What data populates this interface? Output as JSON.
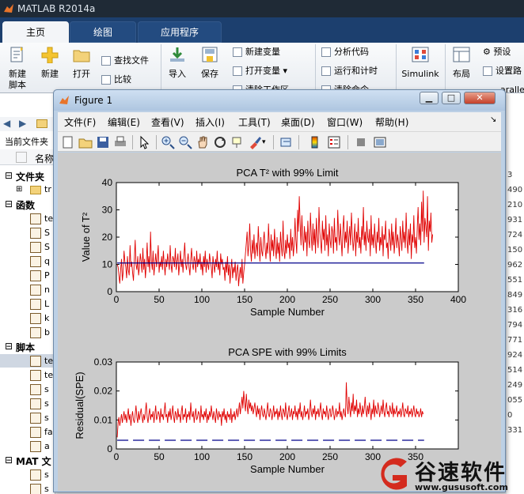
{
  "app": {
    "title": "MATLAB R2014a"
  },
  "tabs": [
    {
      "label": "主页"
    },
    {
      "label": "绘图"
    },
    {
      "label": "应用程序"
    }
  ],
  "ribbon": {
    "new_script": "新建\n脚本",
    "new": "新建",
    "open": "打开",
    "find_files": "查找文件",
    "compare": "比较",
    "import": "导入",
    "save": "保存",
    "new_variable": "新建变量",
    "open_variable": "打开变量",
    "clear_workspace": "清除工作区",
    "analyze_code": "分析代码",
    "run_and_time": "运行和计时",
    "clear_commands": "清除命令",
    "simulink": "Simulink",
    "layout": "布局",
    "preferences": "预设",
    "set_path": "设置路",
    "parallel": "aralle"
  },
  "left_panel": {
    "current_folder": "当前文件夹",
    "name_header": "名称",
    "sections": {
      "folders": "文件夹",
      "functions": "函数",
      "scripts": "脚本",
      "mat": "MAT 文"
    },
    "folder_item": "tr",
    "function_items": [
      "te",
      "S",
      "S",
      "q",
      "P",
      "n",
      "L",
      "k",
      "b"
    ],
    "script_items": [
      "te",
      "te",
      "s",
      "s",
      "s",
      "fa",
      "a"
    ],
    "mat_items": [
      "s",
      "s"
    ]
  },
  "right_numbers": [
    "3",
    "490",
    "210",
    "931",
    "724",
    "150",
    "962",
    "551",
    "849",
    "316",
    "794",
    "771",
    "924",
    "514",
    "249",
    "055",
    "0",
    "331"
  ],
  "figure": {
    "title": "Figure 1",
    "menu": [
      "文件(F)",
      "编辑(E)",
      "查看(V)",
      "插入(I)",
      "工具(T)",
      "桌面(D)",
      "窗口(W)",
      "帮助(H)"
    ],
    "toolbar_icons": [
      "new-figure-icon",
      "open-file-icon",
      "save-icon",
      "print-icon",
      "pointer-icon",
      "zoom-in-icon",
      "zoom-out-icon",
      "pan-icon",
      "rotate-icon",
      "data-cursor-icon",
      "brush-icon",
      "link-icon",
      "colorbar-icon",
      "legend-icon",
      "hide-plot-tools-icon",
      "show-plot-tools-icon"
    ]
  },
  "colors": {
    "series": "#e00000",
    "limit": "#00008b",
    "accent": "#1c3f6e"
  },
  "chart_data": [
    {
      "type": "line",
      "title": "PCA T² with 99% Limit",
      "xlabel": "Sample Number",
      "ylabel": "Value of T²",
      "xlim": [
        0,
        400
      ],
      "ylim": [
        0,
        40
      ],
      "xticks": [
        0,
        50,
        100,
        150,
        200,
        250,
        300,
        350,
        400
      ],
      "yticks": [
        0,
        10,
        20,
        30,
        40
      ],
      "series": [
        {
          "role": "data",
          "x_start": 1,
          "x_step": 1,
          "values": [
            10,
            9,
            6,
            3,
            8,
            12,
            4,
            7,
            15,
            11,
            9,
            5,
            13,
            8,
            6,
            17,
            9,
            11,
            7,
            4,
            12,
            19,
            10,
            8,
            13,
            6,
            9,
            14,
            11,
            7,
            16,
            8,
            12,
            5,
            10,
            18,
            9,
            13,
            7,
            22,
            11,
            8,
            15,
            6,
            10,
            14,
            9,
            12,
            17,
            7,
            11,
            9,
            13,
            8,
            15,
            10,
            6,
            12,
            9,
            14,
            11,
            8,
            17,
            10,
            7,
            13,
            12,
            9,
            16,
            8,
            11,
            14,
            6,
            10,
            15,
            9,
            12,
            7,
            13,
            18,
            10,
            8,
            11,
            14,
            9,
            6,
            12,
            16,
            10,
            8,
            13,
            11,
            7,
            15,
            9,
            12,
            10,
            14,
            8,
            11,
            6,
            13,
            9,
            15,
            7,
            12,
            10,
            8,
            14,
            11,
            9,
            5,
            13,
            10,
            7,
            12,
            9,
            15,
            8,
            11,
            6,
            14,
            10,
            12,
            8,
            9,
            4,
            11,
            7,
            13,
            6,
            10,
            3,
            8,
            12,
            5,
            9,
            7,
            11,
            4,
            8,
            10,
            2,
            6,
            9,
            5,
            12,
            3,
            7,
            10,
            14,
            18,
            22,
            13,
            17,
            25,
            15,
            11,
            19,
            14,
            21,
            12,
            16,
            18,
            13,
            24,
            17,
            11,
            20,
            15,
            13,
            19,
            22,
            16,
            12,
            18,
            14,
            25,
            17,
            11,
            21,
            15,
            19,
            13,
            23,
            16,
            12,
            20,
            14,
            18,
            11,
            22,
            17,
            13,
            26,
            15,
            12,
            19,
            14,
            21,
            16,
            18,
            12,
            23,
            15,
            20,
            13,
            17,
            27,
            19,
            14,
            30,
            22,
            35,
            25,
            17,
            28,
            20,
            15,
            24,
            18,
            22,
            13,
            26,
            19,
            16,
            29,
            21,
            15,
            25,
            17,
            23,
            14,
            27,
            20,
            16,
            31,
            22,
            18,
            14,
            26,
            19,
            23,
            15,
            28,
            17,
            21,
            13,
            25,
            19,
            16,
            24,
            22,
            14,
            27,
            18,
            20,
            15,
            30,
            21,
            17,
            25,
            19,
            13,
            23,
            28,
            16,
            22,
            18,
            26,
            14,
            20,
            24,
            17,
            29,
            21,
            15,
            19,
            25,
            13,
            22,
            18,
            27,
            16,
            20,
            14,
            24,
            19,
            31,
            17,
            22,
            15,
            26,
            20,
            18,
            23,
            13,
            28,
            17,
            21,
            16,
            25,
            19,
            14,
            22,
            18,
            27,
            15,
            20,
            17,
            24,
            13,
            21,
            19,
            26,
            16,
            18,
            12,
            23,
            20,
            15,
            25,
            17,
            22,
            14,
            19,
            27,
            16,
            21,
            18,
            13,
            24,
            20,
            15,
            26,
            18,
            22,
            16,
            29,
            19,
            14,
            23,
            17,
            25,
            12,
            21,
            18,
            28,
            16,
            20,
            14,
            24,
            31,
            19,
            25,
            17,
            33,
            22,
            37,
            18,
            27,
            24,
            20,
            35,
            15,
            26,
            22,
            29,
            18,
            21
          ]
        },
        {
          "role": "limit",
          "name": "99% Limit",
          "x_start": 1,
          "x_end": 360,
          "value": 10.5
        }
      ]
    },
    {
      "type": "line",
      "title": "PCA SPE with 99% Limits",
      "xlabel": "Sample Number",
      "ylabel": "Residual(SPE)",
      "xlim": [
        0,
        400
      ],
      "ylim": [
        0,
        0.03
      ],
      "xticks": [
        0,
        50,
        100,
        150,
        200,
        250,
        300,
        350
      ],
      "yticks": [
        0,
        0.01,
        0.02,
        0.03
      ],
      "series": [
        {
          "role": "data",
          "x_start": 1,
          "x_step": 1,
          "values": [
            0.004,
            0.009,
            0.011,
            0.008,
            0.01,
            0.012,
            0.009,
            0.011,
            0.013,
            0.01,
            0.012,
            0.009,
            0.011,
            0.014,
            0.01,
            0.012,
            0.008,
            0.011,
            0.013,
            0.01,
            0.009,
            0.012,
            0.015,
            0.011,
            0.009,
            0.013,
            0.01,
            0.012,
            0.014,
            0.011,
            0.009,
            0.012,
            0.01,
            0.013,
            0.016,
            0.011,
            0.009,
            0.012,
            0.014,
            0.01,
            0.012,
            0.011,
            0.013,
            0.009,
            0.012,
            0.015,
            0.01,
            0.011,
            0.013,
            0.012,
            0.009,
            0.014,
            0.011,
            0.012,
            0.01,
            0.013,
            0.016,
            0.011,
            0.012,
            0.009,
            0.013,
            0.011,
            0.014,
            0.01,
            0.012,
            0.015,
            0.011,
            0.009,
            0.013,
            0.012,
            0.01,
            0.014,
            0.011,
            0.012,
            0.009,
            0.013,
            0.015,
            0.01,
            0.012,
            0.011,
            0.014,
            0.009,
            0.012,
            0.011,
            0.013,
            0.01,
            0.016,
            0.012,
            0.011,
            0.013,
            0.009,
            0.012,
            0.014,
            0.01,
            0.011,
            0.013,
            0.012,
            0.009,
            0.015,
            0.011,
            0.012,
            0.01,
            0.013,
            0.011,
            0.014,
            0.009,
            0.012,
            0.01,
            0.013,
            0.011,
            0.015,
            0.012,
            0.01,
            0.013,
            0.011,
            0.009,
            0.014,
            0.012,
            0.01,
            0.013,
            0.011,
            0.012,
            0.008,
            0.013,
            0.011,
            0.014,
            0.01,
            0.012,
            0.009,
            0.013,
            0.011,
            0.012,
            0.01,
            0.014,
            0.009,
            0.012,
            0.011,
            0.013,
            0.01,
            0.012,
            0.014,
            0.011,
            0.013,
            0.016,
            0.012,
            0.015,
            0.018,
            0.014,
            0.02,
            0.016,
            0.013,
            0.019,
            0.015,
            0.012,
            0.017,
            0.014,
            0.016,
            0.013,
            0.015,
            0.012,
            0.014,
            0.016,
            0.013,
            0.011,
            0.015,
            0.012,
            0.014,
            0.01,
            0.013,
            0.015,
            0.012,
            0.011,
            0.014,
            0.012,
            0.01,
            0.013,
            0.016,
            0.012,
            0.011,
            0.014,
            0.013,
            0.01,
            0.012,
            0.015,
            0.011,
            0.013,
            0.012,
            0.014,
            0.01,
            0.013,
            0.011,
            0.015,
            0.012,
            0.01,
            0.014,
            0.013,
            0.011,
            0.016,
            0.012,
            0.01,
            0.013,
            0.015,
            0.011,
            0.012,
            0.014,
            0.01,
            0.013,
            0.012,
            0.015,
            0.011,
            0.013,
            0.01,
            0.014,
            0.012,
            0.016,
            0.011,
            0.013,
            0.01,
            0.012,
            0.015,
            0.011,
            0.013,
            0.012,
            0.014,
            0.01,
            0.012,
            0.017,
            0.013,
            0.011,
            0.014,
            0.012,
            0.015,
            0.01,
            0.013,
            0.012,
            0.014,
            0.011,
            0.013,
            0.016,
            0.012,
            0.01,
            0.014,
            0.012,
            0.013,
            0.011,
            0.015,
            0.012,
            0.01,
            0.013,
            0.014,
            0.011,
            0.012,
            0.015,
            0.013,
            0.01,
            0.012,
            0.014,
            0.011,
            0.013,
            0.012,
            0.016,
            0.011,
            0.013,
            0.01,
            0.012,
            0.014,
            0.012,
            0.011,
            0.023,
            0.015,
            0.012,
            0.018,
            0.014,
            0.011,
            0.016,
            0.013,
            0.019,
            0.012,
            0.015,
            0.013,
            0.017,
            0.011,
            0.014,
            0.012,
            0.016,
            0.013,
            0.011,
            0.015,
            0.012,
            0.014,
            0.018,
            0.013,
            0.011,
            0.015,
            0.012,
            0.016,
            0.013,
            0.01,
            0.014,
            0.012,
            0.017,
            0.011,
            0.015,
            0.013,
            0.012,
            0.016,
            0.014,
            0.011,
            0.013,
            0.015,
            0.012,
            0.017,
            0.013,
            0.011,
            0.014,
            0.016,
            0.012,
            0.013,
            0.011,
            0.015,
            0.013,
            0.012,
            0.016,
            0.011,
            0.014,
            0.012,
            0.013,
            0.015,
            0.011,
            0.013,
            0.012,
            0.014,
            0.011,
            0.013,
            0.016,
            0.012,
            0.011,
            0.014,
            0.013,
            0.012,
            0.015,
            0.011,
            0.013,
            0.012,
            0.014,
            0.011,
            0.013,
            0.015,
            0.012,
            0.011,
            0.014,
            0.012,
            0.013,
            0.011,
            0.012,
            0.014,
            0.011,
            0.013,
            0.012
          ]
        },
        {
          "role": "limit",
          "name": "99% Limits",
          "x_start": 1,
          "x_end": 360,
          "value": 0.003
        }
      ]
    }
  ],
  "watermark": {
    "brand": "谷速软件",
    "url": "www.gususoft.com"
  }
}
